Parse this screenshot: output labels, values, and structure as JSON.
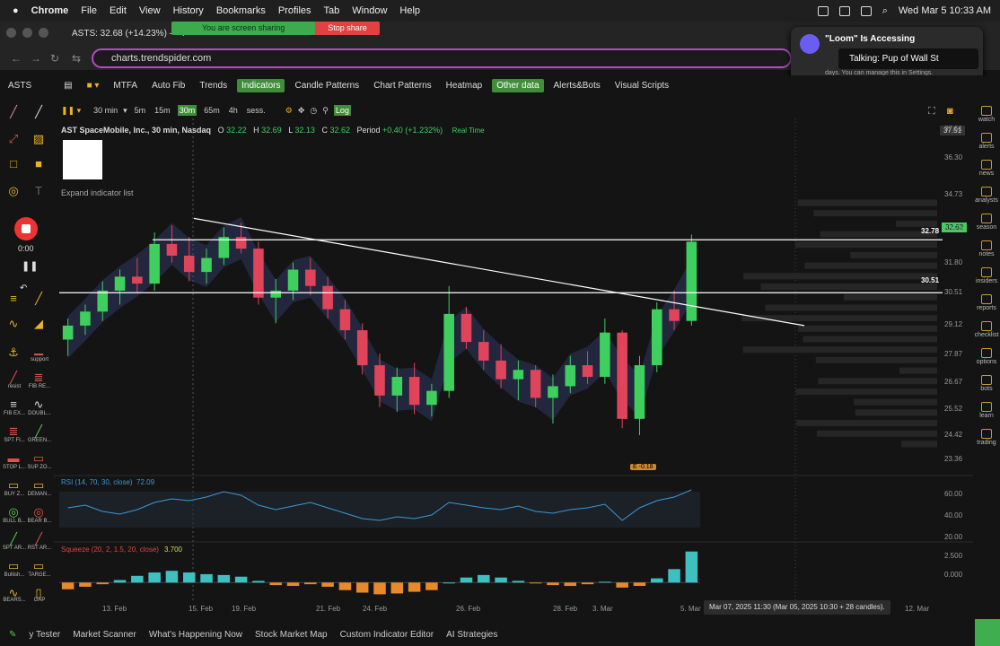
{
  "macbar": {
    "app": "Chrome",
    "menus": [
      "File",
      "Edit",
      "View",
      "History",
      "Bookmarks",
      "Profiles",
      "Tab",
      "Window",
      "Help"
    ],
    "clock": "Wed Mar 5  10:33 AM"
  },
  "tab": {
    "title": "ASTS: 32.68 (+14.23%) — T"
  },
  "share": {
    "sharing": "You are screen sharing",
    "stop": "Stop share"
  },
  "address": {
    "url": "charts.trendspider.com"
  },
  "loom": {
    "title": "\"Loom\" Is Accessing",
    "body": "days. You can manage this in Settings.",
    "talking": "Talking: Pup of Wall St"
  },
  "toolbar": {
    "symbol": "ASTS",
    "buttons": [
      "MTFA",
      "Auto Fib",
      "Trends",
      "Indicators",
      "Candle Patterns",
      "Chart Patterns",
      "Heatmap",
      "Other data",
      "Alerts&Bots",
      "Visual Scripts"
    ],
    "active": [
      "Indicators",
      "Other data"
    ]
  },
  "chart_toolbar": {
    "interval": "30 min",
    "timeframes": [
      "5m",
      "15m",
      "30m",
      "65m",
      "4h",
      "sess."
    ],
    "active_tf": "30m",
    "log": "Log"
  },
  "legend": {
    "title": "AST SpaceMobile, Inc., 30 min, Nasdaq",
    "o_label": "O",
    "o": "32.22",
    "h_label": "H",
    "h": "32.69",
    "l_label": "L",
    "l": "32.13",
    "c_label": "C",
    "c": "32.62",
    "period_label": "Period",
    "period": "+0.40 (+1.232%)",
    "realtime": "Real Time",
    "expand": "Expand indicator list"
  },
  "recorder": {
    "time": "0:00"
  },
  "left_tools": [
    {
      "label": "support"
    },
    {
      "label": "resist"
    },
    {
      "label": "FIB RE..."
    },
    {
      "label": "FIB EX..."
    },
    {
      "label": "DOUBL..."
    },
    {
      "label": "SPT FI..."
    },
    {
      "label": "GREEN..."
    },
    {
      "label": "STOP L..."
    },
    {
      "label": "SUP ZO..."
    },
    {
      "label": "BUY Z..."
    },
    {
      "label": "DEMAN..."
    },
    {
      "label": "BULL B..."
    },
    {
      "label": "BEAR B..."
    },
    {
      "label": "SPT AR..."
    },
    {
      "label": "RST AR..."
    },
    {
      "label": "Bullish..."
    },
    {
      "label": "TARGE..."
    },
    {
      "label": "BEARS..."
    },
    {
      "label": "GAP"
    }
  ],
  "right_tools": [
    "watch",
    "alerts",
    "news",
    "analysts",
    "season",
    "notes",
    "insiders",
    "reports",
    "checklist",
    "options",
    "bots",
    "learn",
    "trading"
  ],
  "chart_data": {
    "type": "candlestick",
    "symbol": "ASTS",
    "y_ticks": [
      "37.51",
      "36.30",
      "34.73",
      "33.24",
      "31.80",
      "30.51",
      "29.12",
      "27.87",
      "26.67",
      "25.52",
      "24.42",
      "23.36"
    ],
    "ylim": [
      22.9,
      37.6
    ],
    "x_ticks": [
      "13. Feb",
      "15. Feb",
      "19. Feb",
      "21. Feb",
      "24. Feb",
      "26. Feb",
      "28. Feb",
      "3. Mar",
      "5. Mar",
      "7. Mar",
      "12. Mar"
    ],
    "horizontal_lines": [
      {
        "value": 32.78,
        "label": "32.78"
      },
      {
        "value": 30.51,
        "label": "30.51"
      }
    ],
    "trendline": {
      "from": [
        "15. Feb",
        33.7
      ],
      "to": [
        "7. Mar",
        29.1
      ]
    },
    "last_price": "32.62",
    "earnings_badge": "E -0.18",
    "ohlc": [
      [
        28.5,
        29.4,
        27.8,
        29.1
      ],
      [
        29.1,
        30.0,
        28.7,
        29.7
      ],
      [
        29.7,
        31.0,
        29.3,
        30.6
      ],
      [
        30.6,
        31.5,
        30.0,
        31.2
      ],
      [
        31.2,
        32.0,
        30.5,
        30.9
      ],
      [
        30.9,
        33.1,
        30.6,
        32.6
      ],
      [
        32.6,
        33.4,
        31.8,
        32.1
      ],
      [
        32.1,
        32.9,
        31.0,
        31.4
      ],
      [
        31.4,
        32.4,
        30.9,
        32.0
      ],
      [
        32.0,
        33.3,
        31.7,
        32.9
      ],
      [
        32.9,
        33.5,
        32.2,
        32.4
      ],
      [
        32.4,
        32.7,
        30.0,
        30.3
      ],
      [
        30.3,
        31.1,
        29.2,
        30.6
      ],
      [
        30.6,
        31.8,
        30.2,
        31.5
      ],
      [
        31.5,
        32.0,
        30.4,
        30.8
      ],
      [
        30.8,
        31.2,
        29.4,
        29.8
      ],
      [
        29.8,
        30.2,
        28.5,
        28.9
      ],
      [
        28.9,
        29.2,
        27.0,
        27.4
      ],
      [
        27.4,
        27.9,
        25.6,
        26.1
      ],
      [
        26.1,
        27.3,
        25.4,
        26.9
      ],
      [
        26.9,
        27.5,
        25.3,
        25.7
      ],
      [
        25.7,
        26.6,
        25.2,
        26.3
      ],
      [
        26.3,
        30.8,
        26.0,
        29.6
      ],
      [
        29.6,
        29.9,
        28.1,
        28.4
      ],
      [
        28.4,
        28.9,
        27.2,
        27.6
      ],
      [
        27.6,
        28.3,
        26.4,
        26.8
      ],
      [
        26.8,
        27.6,
        25.9,
        27.2
      ],
      [
        27.2,
        27.4,
        25.6,
        26.0
      ],
      [
        26.0,
        27.0,
        24.9,
        26.5
      ],
      [
        26.5,
        27.8,
        26.2,
        27.4
      ],
      [
        27.4,
        28.0,
        26.6,
        26.9
      ],
      [
        26.9,
        29.4,
        26.6,
        28.8
      ],
      [
        28.8,
        28.9,
        24.7,
        25.1
      ],
      [
        25.1,
        27.8,
        24.4,
        27.4
      ],
      [
        27.4,
        30.1,
        27.1,
        29.8
      ],
      [
        29.8,
        30.6,
        28.9,
        29.3
      ],
      [
        29.3,
        33.0,
        29.1,
        32.7
      ]
    ],
    "rsi": {
      "label": "RSI (14, 70, 30, close)",
      "value": "72.09",
      "y_ticks": [
        "60.00",
        "40.00",
        "20.00"
      ],
      "ylim": [
        18,
        82
      ],
      "values": [
        52,
        55,
        48,
        45,
        50,
        58,
        62,
        60,
        64,
        70,
        66,
        55,
        50,
        54,
        58,
        52,
        46,
        40,
        38,
        42,
        40,
        44,
        58,
        55,
        52,
        50,
        54,
        48,
        46,
        50,
        52,
        56,
        38,
        52,
        60,
        64,
        72
      ]
    },
    "squeeze": {
      "label": "Squeeze (20, 2, 1.5, 20, close)",
      "value": "3.700",
      "y_ticks": [
        "2.500",
        "0.000"
      ],
      "ylim": [
        -2.0,
        4.2
      ],
      "values": [
        -0.8,
        -0.5,
        -0.2,
        0.3,
        0.8,
        1.2,
        1.4,
        1.2,
        1.0,
        0.9,
        0.7,
        0.2,
        -0.3,
        -0.4,
        -0.2,
        -0.5,
        -0.9,
        -1.2,
        -1.4,
        -1.3,
        -1.1,
        -0.9,
        0.0,
        0.6,
        0.9,
        0.6,
        0.2,
        -0.1,
        -0.3,
        -0.4,
        -0.2,
        0.1,
        -0.6,
        -0.4,
        0.5,
        1.6,
        3.7
      ]
    },
    "colors": {
      "up": "#3fcf5f",
      "down": "#e0445a",
      "rsi": "#3d97d9",
      "sq_up": "#3fc0c0",
      "sq_down": "#e8892a"
    }
  },
  "tooltip": {
    "text": "Mar 07, 2025 11:30 (Mar 05, 2025 10:30 + 28 candles)."
  },
  "bottom": {
    "links": [
      "y Tester",
      "Market Scanner",
      "What's Happening Now",
      "Stock Market Map",
      "Custom Indicator Editor",
      "AI Strategies"
    ]
  }
}
